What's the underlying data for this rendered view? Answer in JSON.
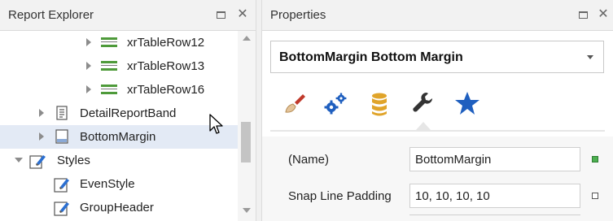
{
  "explorer": {
    "title": "Report Explorer",
    "tree": [
      {
        "label": "xrTableRow12",
        "icon": "table-row-icon",
        "level": 3,
        "expander": "collapsed"
      },
      {
        "label": "xrTableRow13",
        "icon": "table-row-icon",
        "level": 3,
        "expander": "collapsed"
      },
      {
        "label": "xrTableRow16",
        "icon": "table-row-icon",
        "level": 3,
        "expander": "collapsed"
      },
      {
        "label": "DetailReportBand",
        "icon": "detail-report-band-icon",
        "level": 2,
        "expander": "collapsed"
      },
      {
        "label": "BottomMargin",
        "icon": "bottom-margin-band-icon",
        "level": 2,
        "expander": "collapsed",
        "selected": true
      },
      {
        "label": "Styles",
        "icon": "styles-icon",
        "level": 1,
        "expander": "expanded"
      },
      {
        "label": "EvenStyle",
        "icon": "style-icon",
        "level": 2,
        "expander": "none"
      },
      {
        "label": "GroupHeader",
        "icon": "style-icon",
        "level": 2,
        "expander": "none"
      }
    ],
    "header_icons": [
      "restore-icon",
      "close-icon"
    ],
    "close_glyph": "✕"
  },
  "properties": {
    "title": "Properties",
    "close_glyph": "✕",
    "selector": {
      "value": "BottomMargin  Bottom Margin"
    },
    "tabs": [
      {
        "icon": "appearance-brush-icon",
        "color": "#c0392b"
      },
      {
        "icon": "behavior-gears-icon",
        "color": "#1f5fbf"
      },
      {
        "icon": "data-database-icon",
        "color": "#e0a42a"
      },
      {
        "icon": "design-wrench-icon",
        "color": "#333333",
        "active": true
      },
      {
        "icon": "favorites-star-icon",
        "color": "#1f5fbf"
      }
    ],
    "grid": [
      {
        "name": "(Name)",
        "value": "BottomMargin",
        "marker": "set"
      },
      {
        "name": "Snap Line Padding",
        "value": "10, 10, 10, 10",
        "marker": "unset"
      }
    ]
  },
  "colors": {
    "selection": "#e3eaf5",
    "accent_blue": "#1f5fbf",
    "table_row_green": "#4e9a3a"
  }
}
